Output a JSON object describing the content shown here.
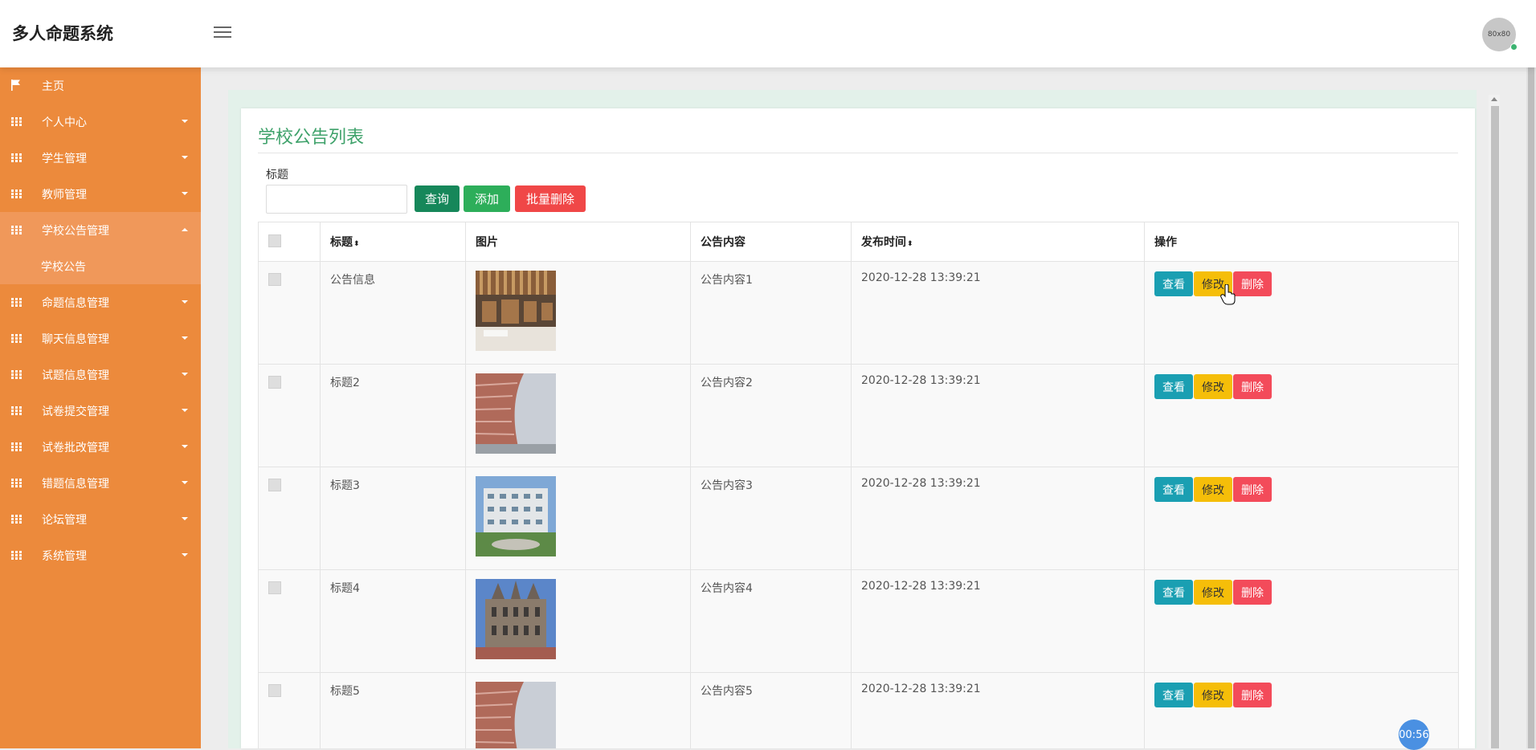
{
  "header": {
    "title": "多人命题系统",
    "avatar_text": "80x80"
  },
  "sidebar": {
    "items": [
      {
        "label": "主页",
        "icon": "flag-icon"
      },
      {
        "label": "个人中心",
        "icon": "grid-icon"
      },
      {
        "label": "学生管理",
        "icon": "grid-icon"
      },
      {
        "label": "教师管理",
        "icon": "grid-icon"
      },
      {
        "label": "学校公告管理",
        "icon": "grid-icon",
        "expanded": true,
        "children": [
          {
            "label": "学校公告"
          }
        ]
      },
      {
        "label": "命题信息管理",
        "icon": "grid-icon"
      },
      {
        "label": "聊天信息管理",
        "icon": "grid-icon"
      },
      {
        "label": "试题信息管理",
        "icon": "grid-icon"
      },
      {
        "label": "试卷提交管理",
        "icon": "grid-icon"
      },
      {
        "label": "试卷批改管理",
        "icon": "grid-icon"
      },
      {
        "label": "错题信息管理",
        "icon": "grid-icon"
      },
      {
        "label": "论坛管理",
        "icon": "grid-icon"
      },
      {
        "label": "系统管理",
        "icon": "grid-icon"
      }
    ]
  },
  "main": {
    "title": "学校公告列表",
    "search": {
      "label": "标题",
      "value": "",
      "placeholder": ""
    },
    "buttons": {
      "query": "查询",
      "add": "添加",
      "batch_delete": "批量删除"
    },
    "table": {
      "columns": [
        "",
        "标题",
        "图片",
        "公告内容",
        "发布时间",
        "操作"
      ],
      "sort_icon": "⬍",
      "rows": [
        {
          "title": "公告信息",
          "content": "公告内容1",
          "time": "2020-12-28 13:39:21",
          "image": "library-interior"
        },
        {
          "title": "标题2",
          "content": "公告内容2",
          "time": "2020-12-28 13:39:21",
          "image": "curved-building"
        },
        {
          "title": "标题3",
          "content": "公告内容3",
          "time": "2020-12-28 13:39:21",
          "image": "campus-building"
        },
        {
          "title": "标题4",
          "content": "公告内容4",
          "time": "2020-12-28 13:39:21",
          "image": "gothic-building"
        },
        {
          "title": "标题5",
          "content": "公告内容5",
          "time": "2020-12-28 13:39:21",
          "image": "curved-building"
        }
      ],
      "actions": {
        "view": "查看",
        "edit": "修改",
        "delete": "删除"
      }
    }
  },
  "timer": "00:56",
  "colors": {
    "sidebar": "#ec8a3c",
    "accent_title": "#3fa26b",
    "view": "#1a9fb2",
    "edit": "#f5be09",
    "delete": "#f34b5a"
  }
}
